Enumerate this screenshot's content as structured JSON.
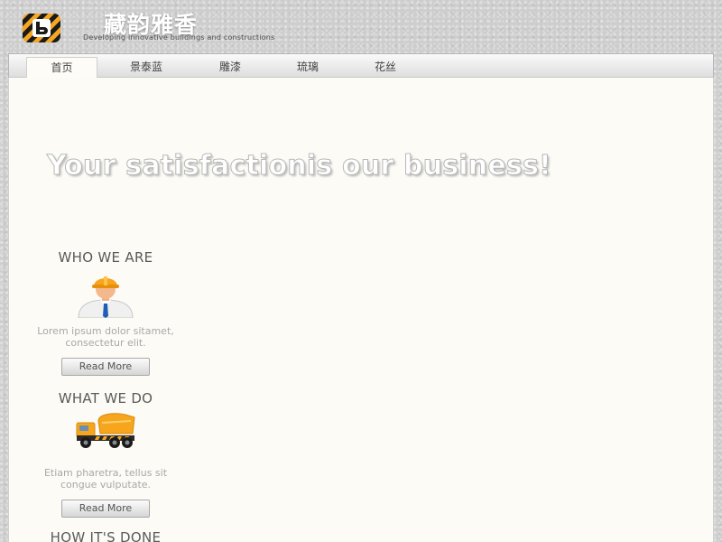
{
  "header": {
    "logo_icon": "logo-badge-icon",
    "site_title": "藏韵雅香",
    "tagline": "Developing innovative buildings and constructions"
  },
  "nav": {
    "tabs": [
      {
        "label": "首页",
        "active": true
      },
      {
        "label": "景泰蓝",
        "active": false
      },
      {
        "label": "雕漆",
        "active": false
      },
      {
        "label": "琉璃",
        "active": false
      },
      {
        "label": "花丝",
        "active": false
      }
    ]
  },
  "hero": {
    "title": "Your satisfactionis our business!"
  },
  "sections": [
    {
      "title": "WHO WE ARE",
      "icon": "construction-worker-icon",
      "description": "Lorem ipsum dolor sitamet, consectetur elit.",
      "button": "Read More"
    },
    {
      "title": "WHAT WE DO",
      "icon": "cement-truck-icon",
      "description": "Etiam pharetra, tellus sit congue vulputate.",
      "button": "Read More"
    },
    {
      "title": "HOW IT'S DONE"
    }
  ],
  "colors": {
    "accent_yellow": "#f5a623",
    "content_bg": "#fcfbf6",
    "page_bg": "#cdcdcd"
  }
}
